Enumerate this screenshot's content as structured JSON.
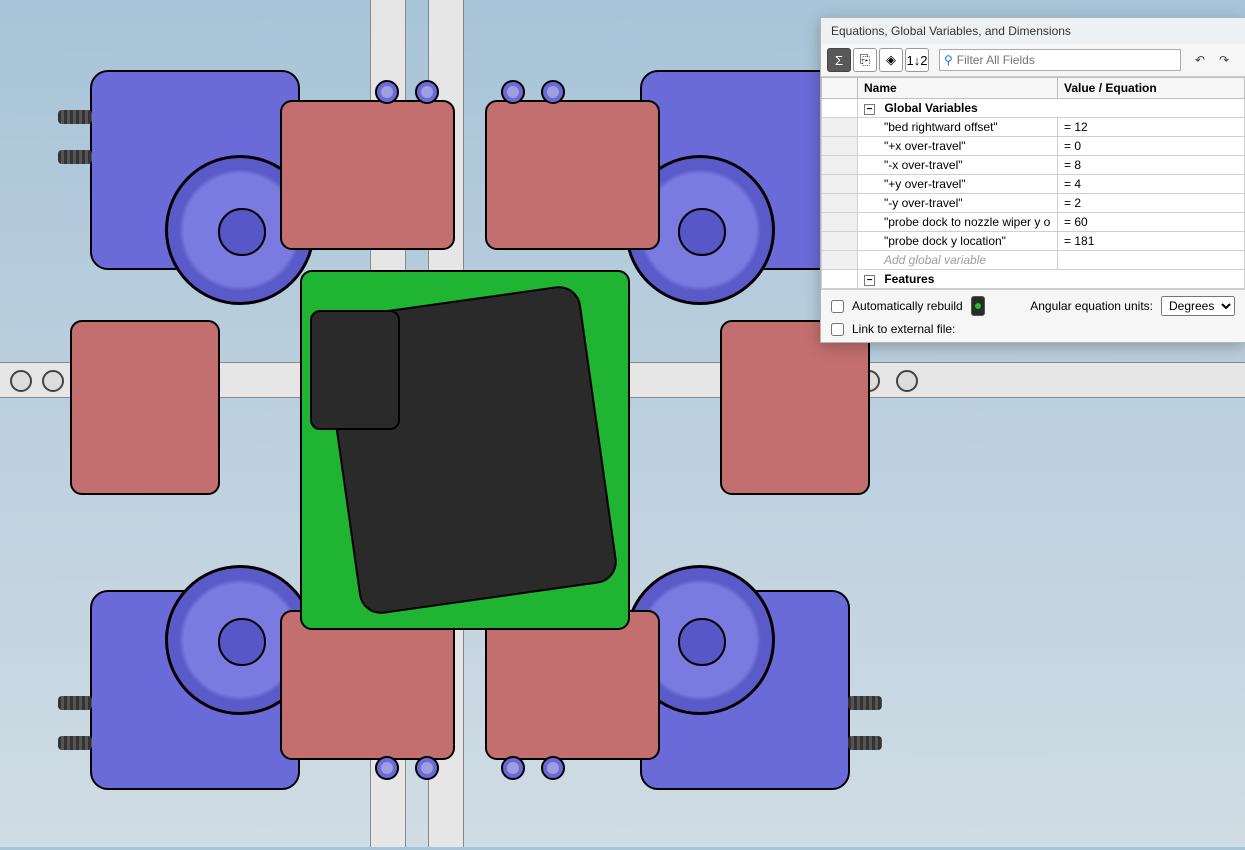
{
  "dialog": {
    "title": "Equations, Global Variables, and Dimensions",
    "toolbar_icons": {
      "sigma": "Σ",
      "link": "⎘",
      "dims": "◈",
      "sort": "1↓2"
    },
    "filter_placeholder": "Filter All Fields",
    "table": {
      "headers": {
        "name": "Name",
        "value": "Value / Equation"
      },
      "groups": {
        "global_vars": "Global Variables",
        "features": "Features"
      },
      "rows": [
        {
          "name": "\"bed rightward offset\"",
          "value": "= 12"
        },
        {
          "name": "\"+x over-travel\"",
          "value": "= 0"
        },
        {
          "name": "\"-x over-travel\"",
          "value": "= 8"
        },
        {
          "name": "\"+y over-travel\"",
          "value": "= 4"
        },
        {
          "name": "\"-y over-travel\"",
          "value": "= 2"
        },
        {
          "name": "\"probe dock to nozzle wiper y o",
          "value": "= 60"
        },
        {
          "name": "\"probe dock y location\"",
          "value": "= 181"
        }
      ],
      "add_placeholder": "Add global variable"
    },
    "footer": {
      "auto_rebuild": "Automatically rebuild",
      "angular_label": "Angular equation units:",
      "angular_value": "Degrees",
      "link_external": "Link to external file:"
    }
  }
}
